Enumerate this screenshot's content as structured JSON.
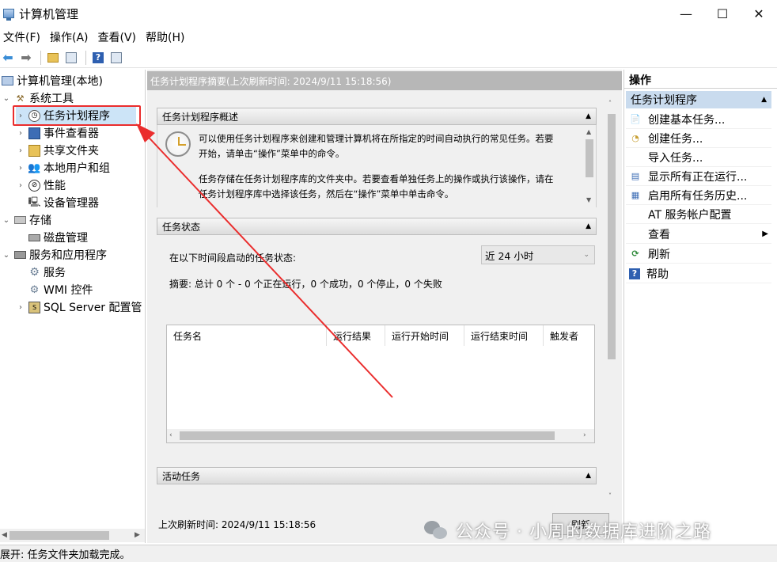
{
  "window": {
    "title": "计算机管理",
    "controls": {
      "minimize": "—",
      "maximize": "☐",
      "close": "✕"
    }
  },
  "menu": [
    "文件(F)",
    "操作(A)",
    "查看(V)",
    "帮助(H)"
  ],
  "tree": {
    "root": "计算机管理(本地)",
    "system_tools": "系统工具",
    "task_scheduler": "任务计划程序",
    "event_viewer": "事件查看器",
    "shared_folders": "共享文件夹",
    "local_users": "本地用户和组",
    "performance": "性能",
    "device_manager": "设备管理器",
    "storage": "存储",
    "disk_management": "磁盘管理",
    "services_apps": "服务和应用程序",
    "services": "服务",
    "wmi": "WMI 控件",
    "sql_server": "SQL Server 配置管"
  },
  "middle": {
    "header": "任务计划程序摘要(上次刷新时间: 2024/9/11 15:18:56)",
    "overview": {
      "title": "任务计划程序概述",
      "line1a": "可以使用任务计划程序来创建和管理计算机将在所指定的时间自动执行的常见任务。若要",
      "line1b": "开始，请单击“操作”菜单中的命令。",
      "line2a": "任务存储在任务计划程序库的文件夹中。若要查看单独任务上的操作或执行该操作，请在",
      "line2b": "任务计划程序库中选择该任务，然后在“操作”菜单中单击命令。"
    },
    "status": {
      "title": "任务状态",
      "label": "在以下时间段启动的任务状态:",
      "period": "近 24 小时",
      "summary": "摘要: 总计 0 个 - 0 个正在运行，0 个成功，0 个停止，0 个失败",
      "columns": [
        "任务名",
        "运行结果",
        "运行开始时间",
        "运行结束时间",
        "触发者"
      ]
    },
    "active": {
      "title": "活动任务"
    },
    "last_refresh": "上次刷新时间: 2024/9/11 15:18:56",
    "refresh_button": "刷新"
  },
  "actions": {
    "title": "操作",
    "section": "任务计划程序",
    "items": [
      "创建基本任务...",
      "创建任务...",
      "导入任务...",
      "显示所有正在运行...",
      "启用所有任务历史...",
      "AT 服务帐户配置",
      "查看",
      "刷新",
      "帮助"
    ]
  },
  "statusbar": "展开: 任务文件夹加载完成。",
  "watermark": "公众号 · 小周的数据库进阶之路",
  "colors": {
    "highlight": "#ea2d2d",
    "selection": "#cce4f7",
    "section": "#c9dbee"
  }
}
